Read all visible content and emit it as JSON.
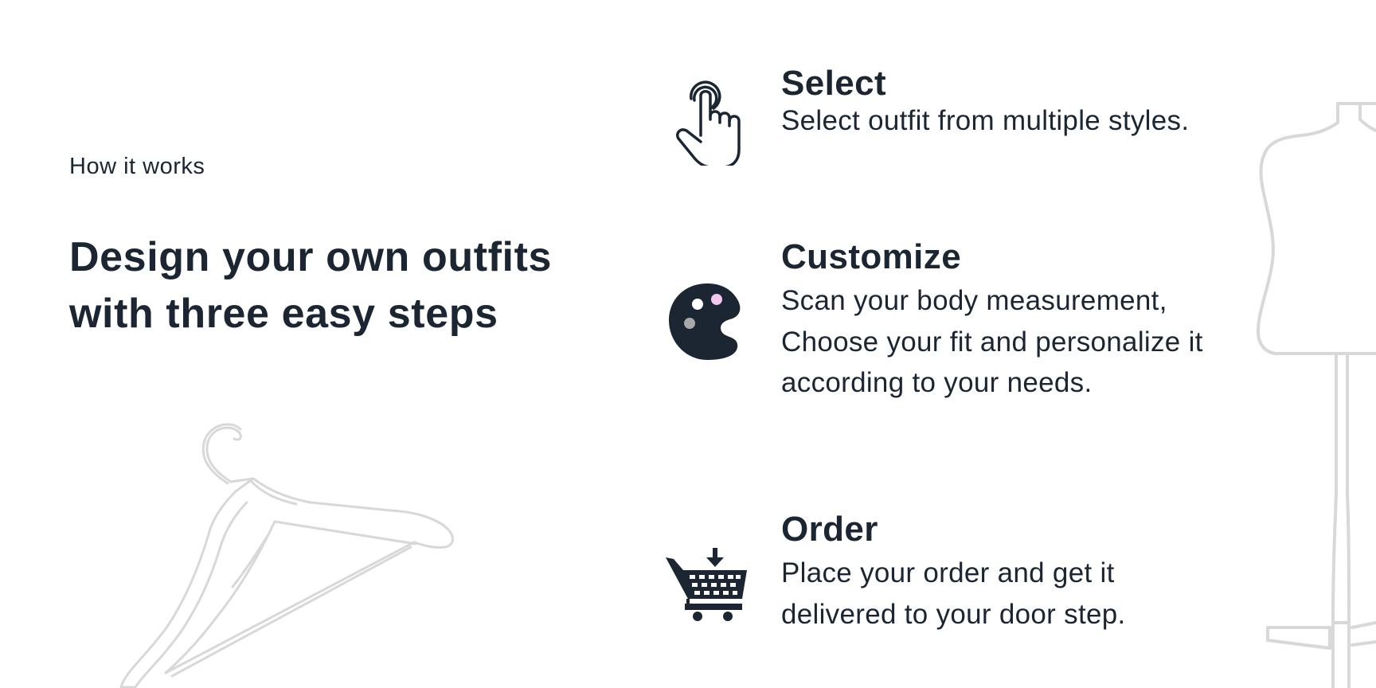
{
  "eyebrow": "How it works",
  "headline": "Design your own outfits with three easy steps",
  "colors": {
    "text": "#1b2632",
    "illustration": "#d8d8d8",
    "palette_pink": "#f3c8f0",
    "palette_gray": "#a8a8a8"
  },
  "steps": [
    {
      "icon": "pointing-hand-icon",
      "title": "Select",
      "description": "Select outfit from multiple styles."
    },
    {
      "icon": "paint-palette-icon",
      "title": "Customize",
      "description": "Scan your body measurement, Choose your fit and personalize it according to your needs."
    },
    {
      "icon": "shopping-cart-icon",
      "title": "Order",
      "description": "Place your order and get it delivered to your door step."
    }
  ],
  "illustrations": [
    "clothes-hanger-icon",
    "dress-form-mannequin-icon"
  ]
}
